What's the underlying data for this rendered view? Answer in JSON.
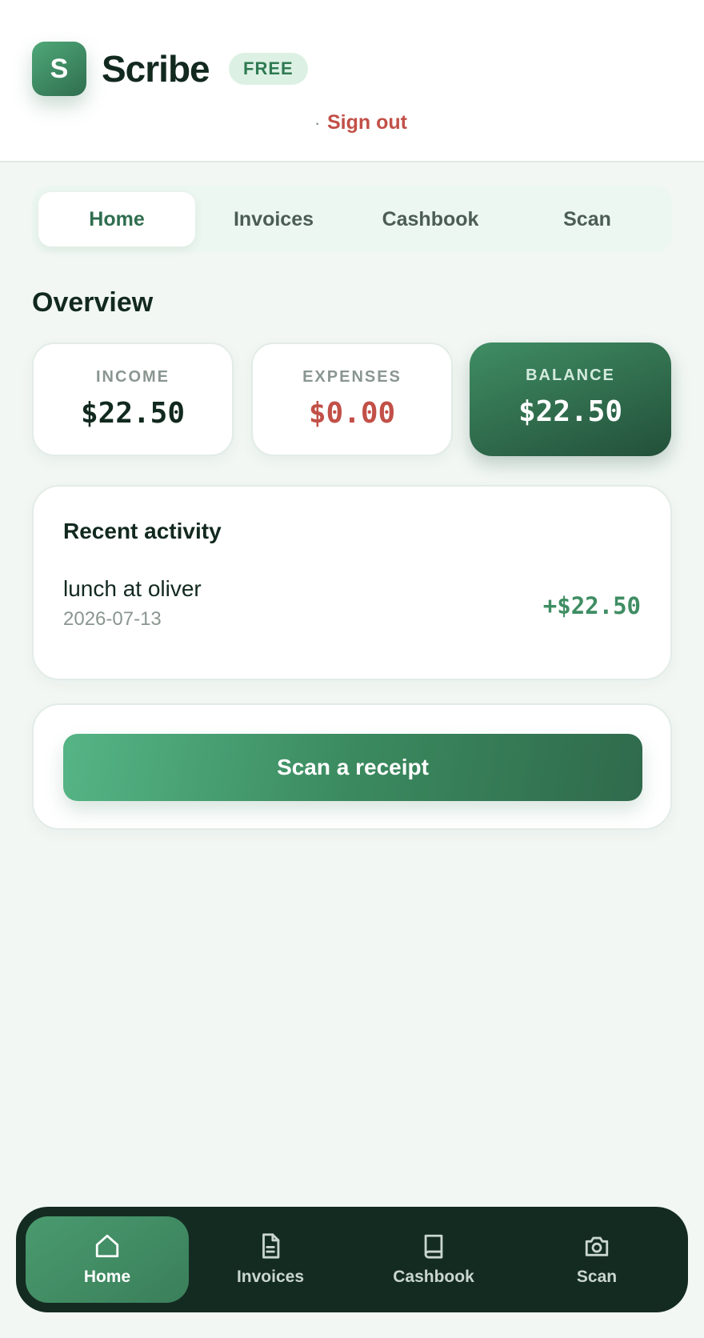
{
  "app": {
    "logo_letter": "S",
    "title": "Scribe",
    "plan_badge": "FREE"
  },
  "account": {
    "email": "",
    "separator": "·",
    "sign_out": "Sign out"
  },
  "tabs": [
    {
      "label": "Home",
      "active": true
    },
    {
      "label": "Invoices",
      "active": false
    },
    {
      "label": "Cashbook",
      "active": false
    },
    {
      "label": "Scan",
      "active": false
    }
  ],
  "overview": {
    "title": "Overview",
    "income": {
      "label": "INCOME",
      "value": "$22.50"
    },
    "expenses": {
      "label": "EXPENSES",
      "value": "$0.00"
    },
    "balance": {
      "label": "BALANCE",
      "value": "$22.50"
    }
  },
  "recent": {
    "title": "Recent activity",
    "items": [
      {
        "name": "lunch at oliver",
        "date": "2026-07-13",
        "amount": "+$22.50"
      }
    ]
  },
  "scan": {
    "button_label": "Scan a receipt"
  },
  "bottom_nav": [
    {
      "label": "Home",
      "icon": "home-icon",
      "active": true
    },
    {
      "label": "Invoices",
      "icon": "document-icon",
      "active": false
    },
    {
      "label": "Cashbook",
      "icon": "book-icon",
      "active": false
    },
    {
      "label": "Scan",
      "icon": "camera-icon",
      "active": false
    }
  ],
  "colors": {
    "brand": "#3f8d63",
    "brand_dark": "#23503a",
    "danger": "#c25048",
    "nav_bg": "#142b22",
    "page_bg": "#f2f7f4"
  }
}
